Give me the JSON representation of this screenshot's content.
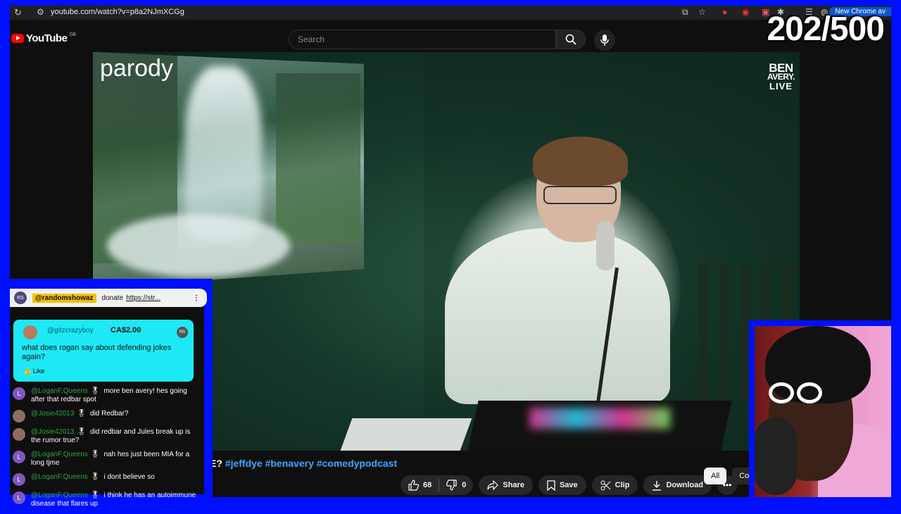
{
  "browser": {
    "url": "youtube.com/watch?v=p8a2NJmXCGg",
    "new_chrome_label": "New Chrome av"
  },
  "header": {
    "logo_text": "YouTube",
    "country_code": "GB",
    "search_placeholder": "Search"
  },
  "video": {
    "overlay_parody": "parody",
    "brand_line1": "BEN",
    "brand_line2": "AVERY.",
    "brand_line3": "LIVE"
  },
  "title_fragment": {
    "lead": "E?",
    "hashtags": "#jeffdye #benavery #comedypodcast"
  },
  "actions": {
    "likes": "68",
    "dislikes": "0",
    "share": "Share",
    "save": "Save",
    "clip": "Clip",
    "download": "Download"
  },
  "chips": {
    "all": "All",
    "second": "Com"
  },
  "counter": "202/500",
  "chat": {
    "pinned": {
      "avatar": "RS",
      "handle": "@randomshowaz",
      "text": "donate",
      "link": "https://str..."
    },
    "superchat": {
      "name": "@gitzcrazyboy",
      "amount": "CA$2.00",
      "badge": "RS",
      "message": "what does rogan say about defending jokes again?",
      "like_label": "Like"
    },
    "messages": [
      {
        "initial": "L",
        "name": "@LoganF.Queens",
        "text": "more ben avery! hes going after that redbar spot",
        "color": "#7e57c2"
      },
      {
        "initial": "",
        "name": "@Josie42013",
        "text": "did Redbar?",
        "color": "#8d6e63"
      },
      {
        "initial": "",
        "name": "@Josie42013",
        "text": "did redbar and Jules break up is the rumor true?",
        "color": "#8d6e63"
      },
      {
        "initial": "L",
        "name": "@LoganF.Queens",
        "text": "nah hes just been MIA for a long tjme",
        "color": "#7e57c2"
      },
      {
        "initial": "L",
        "name": "@LoganF.Queens",
        "text": "i dont believe so",
        "color": "#7e57c2"
      },
      {
        "initial": "L",
        "name": "@LoganF.Queens",
        "text": "i think he has an autoimmune disease that flares up",
        "color": "#7e57c2"
      }
    ]
  },
  "colors": {
    "border_blue": "#0010ff",
    "superchat": "#1de9f6",
    "hashtag": "#3ea6ff",
    "pinned_handle": "#f2c200"
  }
}
